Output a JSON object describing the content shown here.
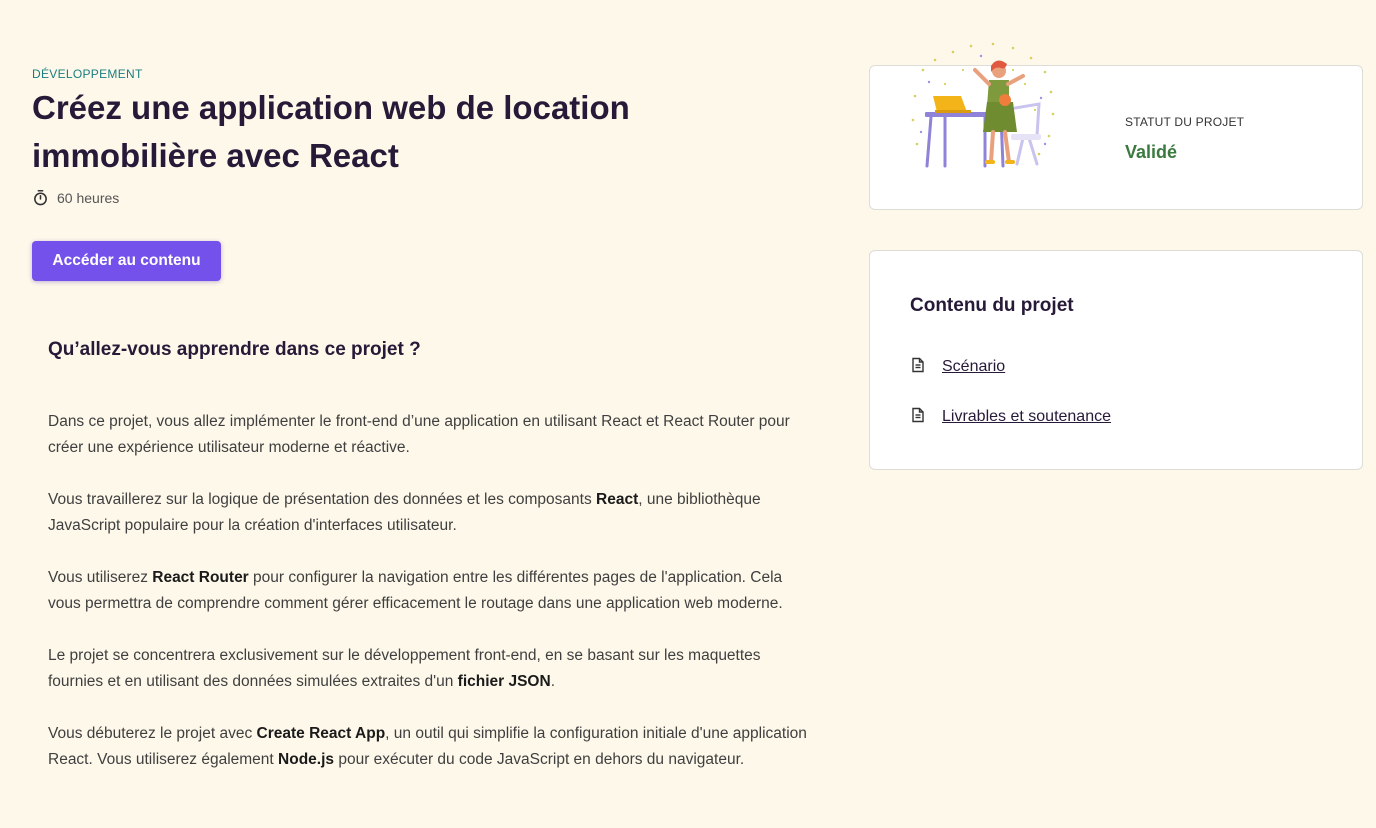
{
  "project": {
    "category": "DÉVELOPPEMENT",
    "title": "Créez une application web de location immobilière avec React",
    "duration": "60 heures",
    "access_button": "Accéder au contenu"
  },
  "learn": {
    "heading": "Qu’allez-vous apprendre dans ce projet ?",
    "paragraphs": [
      [
        {
          "text": "Dans ce projet, vous allez implémenter le front-end d’une application en utilisant React et React Router pour créer une expérience utilisateur moderne et réactive."
        }
      ],
      [
        {
          "text": "Vous travaillerez sur la logique de présentation des données et les composants "
        },
        {
          "text": "React",
          "bold": true
        },
        {
          "text": ", une bibliothèque JavaScript populaire pour la création d'interfaces utilisateur."
        }
      ],
      [
        {
          "text": "Vous utiliserez "
        },
        {
          "text": "React Router",
          "bold": true
        },
        {
          "text": " pour configurer la navigation entre les différentes pages de l'application. Cela vous permettra de comprendre comment gérer efficacement le routage dans une application web moderne."
        }
      ],
      [
        {
          "text": "Le projet se concentrera exclusivement sur le développement front-end, en se basant sur les maquettes fournies et en utilisant des données simulées extraites d'un "
        },
        {
          "text": "fichier JSON",
          "bold": true
        },
        {
          "text": "."
        }
      ],
      [
        {
          "text": "Vous débuterez le projet avec "
        },
        {
          "text": "Create React App",
          "bold": true
        },
        {
          "text": ", un outil qui simplifie la configuration initiale d'une application React. Vous utiliserez également "
        },
        {
          "text": "Node.js",
          "bold": true
        },
        {
          "text": " pour exécuter du code JavaScript en dehors du navigateur."
        }
      ]
    ]
  },
  "status": {
    "label": "STATUT DU PROJET",
    "value": "Validé",
    "value_color": "#3b7a3e"
  },
  "contents": {
    "heading": "Contenu du projet",
    "items": [
      {
        "label": "Scénario",
        "icon": "document-icon"
      },
      {
        "label": "Livrables et soutenance",
        "icon": "document-icon"
      }
    ]
  },
  "colors": {
    "accent": "#7451eb",
    "category": "#1a7d80",
    "background": "#fdf8ea"
  }
}
